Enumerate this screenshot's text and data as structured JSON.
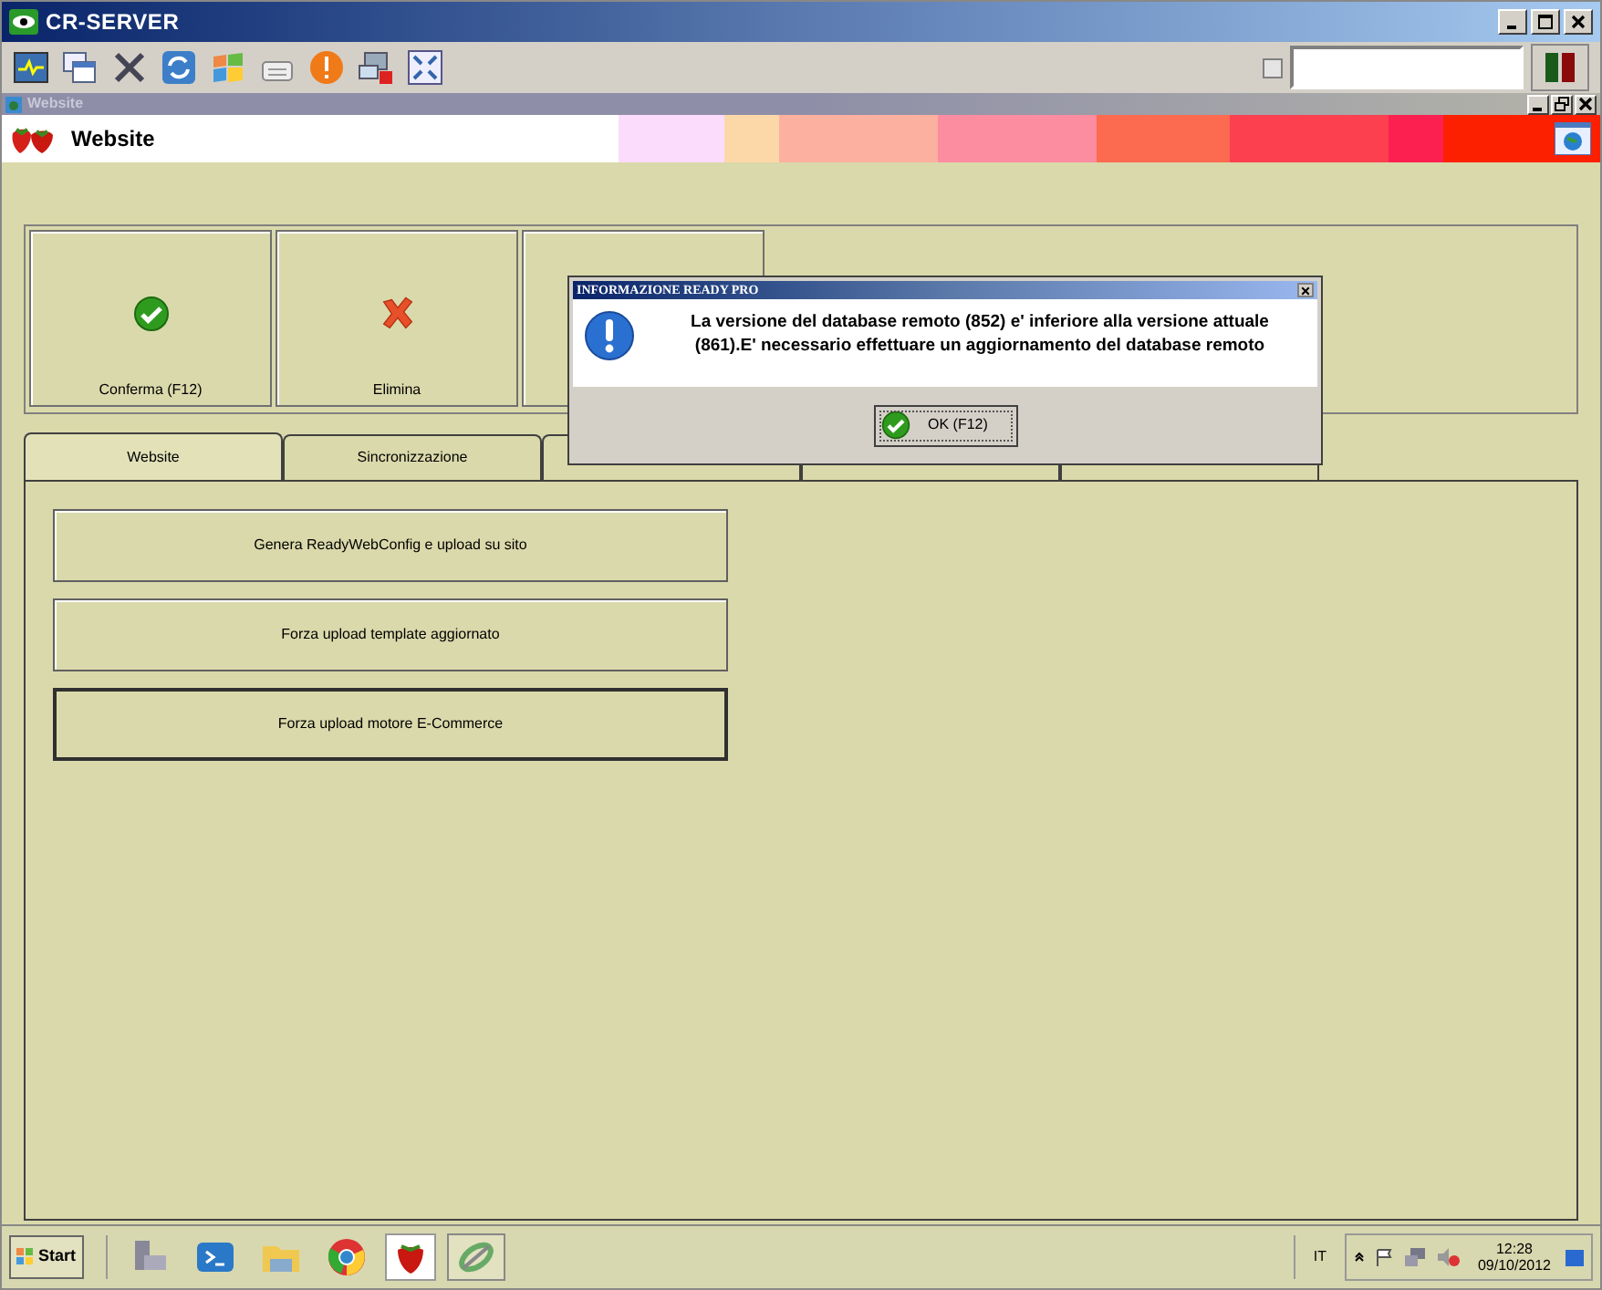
{
  "window": {
    "title": "CR-SERVER"
  },
  "child_window": {
    "title": "Website"
  },
  "header": {
    "title": "Website"
  },
  "toolbar": {
    "checkbox": {
      "checked": false
    }
  },
  "action_buttons": [
    {
      "kind": "confirm",
      "label": "Conferma (F12)"
    },
    {
      "kind": "delete",
      "label": "Elimina"
    },
    {
      "kind": "blank"
    }
  ],
  "tabs": [
    {
      "label": "Website",
      "selected": true
    },
    {
      "label": "Sincronizzazione",
      "selected": false
    },
    {
      "selected": false
    },
    {
      "selected": false
    },
    {
      "selected": false
    }
  ],
  "panel_buttons": [
    {
      "label": "Genera ReadyWebConfig e upload su sito",
      "focused": false
    },
    {
      "label": "Forza upload template aggiornato",
      "focused": false
    },
    {
      "label": "Forza upload motore E-Commerce",
      "focused": true
    }
  ],
  "dialog": {
    "title": "INFORMAZIONE READY PRO",
    "message": "La versione del database remoto (852) e' inferiore alla versione attuale (861).E' necessario effettuare un aggiornamento del database remoto",
    "button": "OK (F12)"
  },
  "taskbar": {
    "start": "Start",
    "language": "IT",
    "time": "12:28",
    "date": "09/10/2012"
  }
}
